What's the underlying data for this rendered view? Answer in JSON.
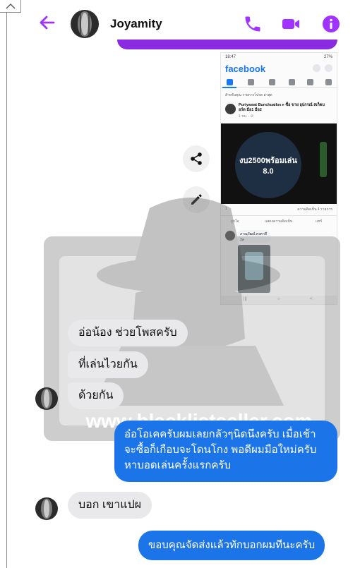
{
  "header": {
    "contact_name": "Joyamity",
    "back_icon": "arrow-left-icon",
    "call_icon": "phone-icon",
    "video_icon": "video-camera-icon",
    "info_icon": "info-icon",
    "accent": "#a033ff"
  },
  "shared_image": {
    "status_time": "18:47",
    "status_right": "27%",
    "app_logo": "facebook",
    "filter_tabs": "สำหรับคุณ    รายการโปรด    ล่าสุด",
    "post_author": "Puriyawat Bunchuailos ▸ ซื้อ ขาย อุปกรณ์ สเก็ตบอร์ด มือ1 มือ2",
    "post_meta": "1 ชม. · ⊘",
    "caption_line1": "งบ2500พร้อมเล่น",
    "caption_line2": "8.0",
    "reactions_left": "1",
    "reactions_right": "ความคิดเห็น 4 รายการ",
    "action_like": "ถูกใจ",
    "action_comment": "แสดงความคิดเห็น",
    "action_share": "แชร์",
    "comment_text": "ภาณุวัฒน์ คงคาดี 3ล",
    "nav_bottom_left": "|||",
    "nav_bottom_mid": "○",
    "nav_bottom_right": "<"
  },
  "actions": {
    "share_icon": "share-icon",
    "edit_icon": "pencil-icon"
  },
  "watermark": {
    "text": "www.blacklistseller.com"
  },
  "messages": [
    {
      "from": "them",
      "text": "อ่อน้อง ช่วยโพสครับ"
    },
    {
      "from": "them",
      "text": "ที่เล่นไวยกัน"
    },
    {
      "from": "them",
      "text": "ด้วยกัน"
    },
    {
      "from": "me",
      "text": "อ๋อโอเคครับผมเลยกลัวๆนิดนึงครับ เมื่อเช้าจะซื้อก็เกือบจะโดนโกง พอดีผมมือใหม่ครับหาบอดเล่นครั้งแรกครับ"
    },
    {
      "from": "them",
      "text": "บอก เขาแปผ"
    },
    {
      "from": "me",
      "text": "ขอบคุณจัดส่งแล้วทักบอกผมทีนะครับ"
    }
  ],
  "colors": {
    "outgoing_bubble": "#1b74e8",
    "incoming_bubble": "#e9e9eb"
  }
}
